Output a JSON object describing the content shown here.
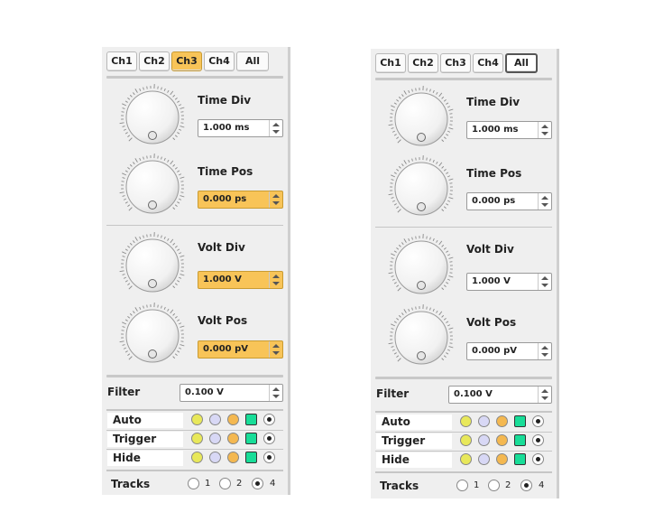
{
  "colors": {
    "active_yellow": "#f8c458",
    "ch1": "#e8e85a",
    "ch2": "#d8d8f5",
    "ch3": "#f4b850",
    "ch4": "#18dd98"
  },
  "panels": [
    {
      "tabs": [
        {
          "label": "Ch1",
          "state": "normal"
        },
        {
          "label": "Ch2",
          "state": "normal"
        },
        {
          "label": "Ch3",
          "state": "selected"
        },
        {
          "label": "Ch4",
          "state": "normal"
        },
        {
          "label": "All",
          "state": "normal"
        }
      ],
      "time_div": {
        "label": "Time Div",
        "value": "1.000 ms",
        "highlight": false
      },
      "time_pos": {
        "label": "Time Pos",
        "value": "0.000 ps",
        "highlight": true
      },
      "volt_div": {
        "label": "Volt Div",
        "value": "1.000 V",
        "highlight": true
      },
      "volt_pos": {
        "label": "Volt Pos",
        "value": "0.000 pV",
        "highlight": true
      },
      "filter": {
        "label": "Filter",
        "value": "0.100 V"
      },
      "rows": [
        {
          "label": "Auto",
          "selected": "last"
        },
        {
          "label": "Trigger",
          "selected": "ch4"
        },
        {
          "label": "Hide",
          "selected": "ch4"
        }
      ],
      "tracks": {
        "label": "Tracks",
        "options": [
          "1",
          "2",
          "4"
        ],
        "selected": "4"
      }
    },
    {
      "tabs": [
        {
          "label": "Ch1",
          "state": "normal"
        },
        {
          "label": "Ch2",
          "state": "normal"
        },
        {
          "label": "Ch3",
          "state": "normal"
        },
        {
          "label": "Ch4",
          "state": "normal"
        },
        {
          "label": "All",
          "state": "focused"
        }
      ],
      "time_div": {
        "label": "Time Div",
        "value": "1.000 ms",
        "highlight": false
      },
      "time_pos": {
        "label": "Time Pos",
        "value": "0.000 ps",
        "highlight": false
      },
      "volt_div": {
        "label": "Volt Div",
        "value": "1.000 V",
        "highlight": false
      },
      "volt_pos": {
        "label": "Volt Pos",
        "value": "0.000 pV",
        "highlight": false
      },
      "filter": {
        "label": "Filter",
        "value": "0.100 V"
      },
      "rows": [
        {
          "label": "Auto",
          "selected": "last"
        },
        {
          "label": "Trigger",
          "selected": "ch4"
        },
        {
          "label": "Hide",
          "selected": "ch4"
        }
      ],
      "tracks": {
        "label": "Tracks",
        "options": [
          "1",
          "2",
          "4"
        ],
        "selected": "4"
      }
    }
  ]
}
